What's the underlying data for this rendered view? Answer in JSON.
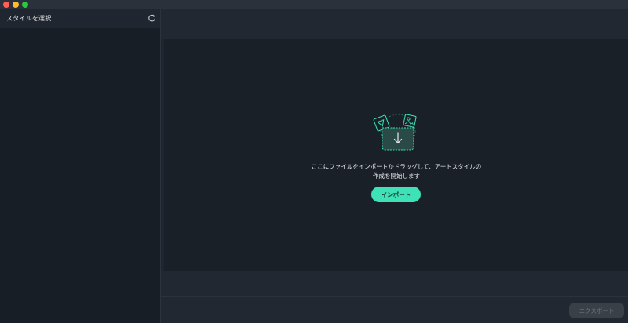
{
  "sidebar": {
    "title": "スタイルを選択",
    "refresh_icon": "refresh-icon"
  },
  "main": {
    "drop_zone": {
      "message_line1": "ここにファイルをインポートかドラッグして、アートスタイルの",
      "message_line2": "作成を開始します",
      "import_label": "インポート",
      "illustration_icon": "image-drop-icon"
    },
    "export_label": "エクスポート",
    "export_enabled": false
  },
  "colors": {
    "accent": "#3ee2b6",
    "background": "#1a2028",
    "sidebar": "#181e25",
    "text": "#e9ebee"
  }
}
